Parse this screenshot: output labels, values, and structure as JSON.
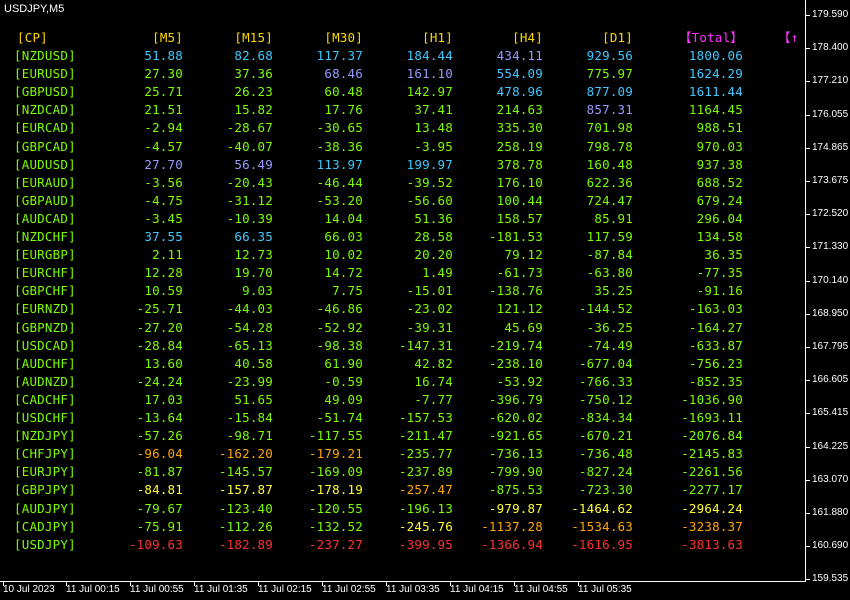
{
  "chart_symbol": "USDJPY,M5",
  "headers": {
    "cp": "[CP]",
    "m5": "[M5]",
    "m15": "[M15]",
    "m30": "[M30]",
    "h1": "[H1]",
    "h4": "[H4]",
    "d1": "[D1]",
    "total": "【Total】",
    "sort": "【↑"
  },
  "rows": [
    {
      "pair": "[NZDUSD]",
      "v": [
        "51.88",
        "82.68",
        "117.37",
        "184.44",
        "434.11",
        "929.56",
        "1800.06"
      ]
    },
    {
      "pair": "[EURUSD]",
      "v": [
        "27.30",
        "37.36",
        "68.46",
        "161.10",
        "554.09",
        "775.97",
        "1624.29"
      ]
    },
    {
      "pair": "[GBPUSD]",
      "v": [
        "25.71",
        "26.23",
        "60.48",
        "142.97",
        "478.96",
        "877.09",
        "1611.44"
      ]
    },
    {
      "pair": "[NZDCAD]",
      "v": [
        "21.51",
        "15.82",
        "17.76",
        "37.41",
        "214.63",
        "857.31",
        "1164.45"
      ]
    },
    {
      "pair": "[EURCAD]",
      "v": [
        "-2.94",
        "-28.67",
        "-30.65",
        "13.48",
        "335.30",
        "701.98",
        "988.51"
      ]
    },
    {
      "pair": "[GBPCAD]",
      "v": [
        "-4.57",
        "-40.07",
        "-38.36",
        "-3.95",
        "258.19",
        "798.78",
        "970.03"
      ]
    },
    {
      "pair": "[AUDUSD]",
      "v": [
        "27.70",
        "56.49",
        "113.97",
        "199.97",
        "378.78",
        "160.48",
        "937.38"
      ]
    },
    {
      "pair": "[EURAUD]",
      "v": [
        "-3.56",
        "-20.43",
        "-46.44",
        "-39.52",
        "176.10",
        "622.36",
        "688.52"
      ]
    },
    {
      "pair": "[GBPAUD]",
      "v": [
        "-4.75",
        "-31.12",
        "-53.20",
        "-56.60",
        "100.44",
        "724.47",
        "679.24"
      ]
    },
    {
      "pair": "[AUDCAD]",
      "v": [
        "-3.45",
        "-10.39",
        "14.04",
        "51.36",
        "158.57",
        "85.91",
        "296.04"
      ]
    },
    {
      "pair": "[NZDCHF]",
      "v": [
        "37.55",
        "66.35",
        "66.03",
        "28.58",
        "-181.53",
        "117.59",
        "134.58"
      ]
    },
    {
      "pair": "[EURGBP]",
      "v": [
        "2.11",
        "12.73",
        "10.02",
        "20.20",
        "79.12",
        "-87.84",
        "36.35"
      ]
    },
    {
      "pair": "[EURCHF]",
      "v": [
        "12.28",
        "19.70",
        "14.72",
        "1.49",
        "-61.73",
        "-63.80",
        "-77.35"
      ]
    },
    {
      "pair": "[GBPCHF]",
      "v": [
        "10.59",
        "9.03",
        "7.75",
        "-15.01",
        "-138.76",
        "35.25",
        "-91.16"
      ]
    },
    {
      "pair": "[EURNZD]",
      "v": [
        "-25.71",
        "-44.03",
        "-46.86",
        "-23.02",
        "121.12",
        "-144.52",
        "-163.03"
      ]
    },
    {
      "pair": "[GBPNZD]",
      "v": [
        "-27.20",
        "-54.28",
        "-52.92",
        "-39.31",
        "45.69",
        "-36.25",
        "-164.27"
      ]
    },
    {
      "pair": "[USDCAD]",
      "v": [
        "-28.84",
        "-65.13",
        "-98.38",
        "-147.31",
        "-219.74",
        "-74.49",
        "-633.87"
      ]
    },
    {
      "pair": "[AUDCHF]",
      "v": [
        "13.60",
        "40.58",
        "61.90",
        "42.82",
        "-238.10",
        "-677.04",
        "-756.23"
      ]
    },
    {
      "pair": "[AUDNZD]",
      "v": [
        "-24.24",
        "-23.99",
        "-0.59",
        "16.74",
        "-53.92",
        "-766.33",
        "-852.35"
      ]
    },
    {
      "pair": "[CADCHF]",
      "v": [
        "17.03",
        "51.65",
        "49.09",
        "-7.77",
        "-396.79",
        "-750.12",
        "-1036.90"
      ]
    },
    {
      "pair": "[USDCHF]",
      "v": [
        "-13.64",
        "-15.84",
        "-51.74",
        "-157.53",
        "-620.02",
        "-834.34",
        "-1693.11"
      ]
    },
    {
      "pair": "[NZDJPY]",
      "v": [
        "-57.26",
        "-98.71",
        "-117.55",
        "-211.47",
        "-921.65",
        "-670.21",
        "-2076.84"
      ]
    },
    {
      "pair": "[CHFJPY]",
      "v": [
        "-96.04",
        "-162.20",
        "-179.21",
        "-235.77",
        "-736.13",
        "-736.48",
        "-2145.83"
      ]
    },
    {
      "pair": "[EURJPY]",
      "v": [
        "-81.87",
        "-145.57",
        "-169.09",
        "-237.89",
        "-799.90",
        "-827.24",
        "-2261.56"
      ]
    },
    {
      "pair": "[GBPJPY]",
      "v": [
        "-84.81",
        "-157.87",
        "-178.19",
        "-257.47",
        "-875.53",
        "-723.30",
        "-2277.17"
      ]
    },
    {
      "pair": "[AUDJPY]",
      "v": [
        "-79.67",
        "-123.40",
        "-120.55",
        "-196.13",
        "-979.87",
        "-1464.62",
        "-2964.24"
      ]
    },
    {
      "pair": "[CADJPY]",
      "v": [
        "-75.91",
        "-112.26",
        "-132.52",
        "-245.76",
        "-1137.28",
        "-1534.63",
        "-3238.37"
      ]
    },
    {
      "pair": "[USDJPY]",
      "v": [
        "-109.63",
        "-182.89",
        "-237.27",
        "-399.95",
        "-1366.94",
        "-1616.95",
        "-3813.63"
      ]
    }
  ],
  "colors": {
    "header": "#ffd700",
    "pair": "#7cfc00",
    "total_header": "#ff33ff",
    "strong_pos": "#3fc9ff",
    "purple": "#9999ff",
    "neutral": "#7cfc00",
    "orange": "#ffa500",
    "yellow": "#ffff33",
    "red": "#ff3030"
  },
  "cell_colors": [
    [
      "strong_pos",
      "strong_pos",
      "strong_pos",
      "strong_pos",
      "purple",
      "strong_pos",
      "strong_pos"
    ],
    [
      "neutral",
      "neutral",
      "purple",
      "purple",
      "strong_pos",
      "neutral",
      "strong_pos"
    ],
    [
      "neutral",
      "neutral",
      "neutral",
      "neutral",
      "strong_pos",
      "strong_pos",
      "strong_pos"
    ],
    [
      "neutral",
      "neutral",
      "neutral",
      "neutral",
      "neutral",
      "purple",
      "neutral"
    ],
    [
      "neutral",
      "neutral",
      "neutral",
      "neutral",
      "neutral",
      "neutral",
      "neutral"
    ],
    [
      "neutral",
      "neutral",
      "neutral",
      "neutral",
      "neutral",
      "neutral",
      "neutral"
    ],
    [
      "purple",
      "purple",
      "strong_pos",
      "strong_pos",
      "neutral",
      "neutral",
      "neutral"
    ],
    [
      "neutral",
      "neutral",
      "neutral",
      "neutral",
      "neutral",
      "neutral",
      "neutral"
    ],
    [
      "neutral",
      "neutral",
      "neutral",
      "neutral",
      "neutral",
      "neutral",
      "neutral"
    ],
    [
      "neutral",
      "neutral",
      "neutral",
      "neutral",
      "neutral",
      "neutral",
      "neutral"
    ],
    [
      "strong_pos",
      "strong_pos",
      "neutral",
      "neutral",
      "neutral",
      "neutral",
      "neutral"
    ],
    [
      "neutral",
      "neutral",
      "neutral",
      "neutral",
      "neutral",
      "neutral",
      "neutral"
    ],
    [
      "neutral",
      "neutral",
      "neutral",
      "neutral",
      "neutral",
      "neutral",
      "neutral"
    ],
    [
      "neutral",
      "neutral",
      "neutral",
      "neutral",
      "neutral",
      "neutral",
      "neutral"
    ],
    [
      "neutral",
      "neutral",
      "neutral",
      "neutral",
      "neutral",
      "neutral",
      "neutral"
    ],
    [
      "neutral",
      "neutral",
      "neutral",
      "neutral",
      "neutral",
      "neutral",
      "neutral"
    ],
    [
      "neutral",
      "neutral",
      "neutral",
      "neutral",
      "neutral",
      "neutral",
      "neutral"
    ],
    [
      "neutral",
      "neutral",
      "neutral",
      "neutral",
      "neutral",
      "neutral",
      "neutral"
    ],
    [
      "neutral",
      "neutral",
      "neutral",
      "neutral",
      "neutral",
      "neutral",
      "neutral"
    ],
    [
      "neutral",
      "neutral",
      "neutral",
      "neutral",
      "neutral",
      "neutral",
      "neutral"
    ],
    [
      "neutral",
      "neutral",
      "neutral",
      "neutral",
      "neutral",
      "neutral",
      "neutral"
    ],
    [
      "neutral",
      "neutral",
      "neutral",
      "neutral",
      "neutral",
      "neutral",
      "neutral"
    ],
    [
      "orange",
      "orange",
      "orange",
      "neutral",
      "neutral",
      "neutral",
      "neutral"
    ],
    [
      "neutral",
      "neutral",
      "neutral",
      "neutral",
      "neutral",
      "neutral",
      "neutral"
    ],
    [
      "yellow",
      "yellow",
      "yellow",
      "orange",
      "neutral",
      "neutral",
      "neutral"
    ],
    [
      "neutral",
      "neutral",
      "neutral",
      "neutral",
      "yellow",
      "yellow",
      "yellow"
    ],
    [
      "neutral",
      "neutral",
      "neutral",
      "yellow",
      "orange",
      "orange",
      "orange"
    ],
    [
      "red",
      "red",
      "red",
      "red",
      "red",
      "red",
      "red"
    ]
  ],
  "price_axis": [
    "179.590",
    "178.400",
    "177.210",
    "176.055",
    "174.865",
    "173.675",
    "172.520",
    "171.330",
    "170.140",
    "168.950",
    "167.795",
    "166.605",
    "165.415",
    "164.225",
    "163.070",
    "161.880",
    "160.690",
    "159.535"
  ],
  "time_axis": [
    "10 Jul 2023",
    "11 Jul 00:15",
    "11 Jul 00:55",
    "11 Jul 01:35",
    "11 Jul 02:15",
    "11 Jul 02:55",
    "11 Jul 03:35",
    "11 Jul 04:15",
    "11 Jul 04:55",
    "11 Jul 05:35"
  ]
}
